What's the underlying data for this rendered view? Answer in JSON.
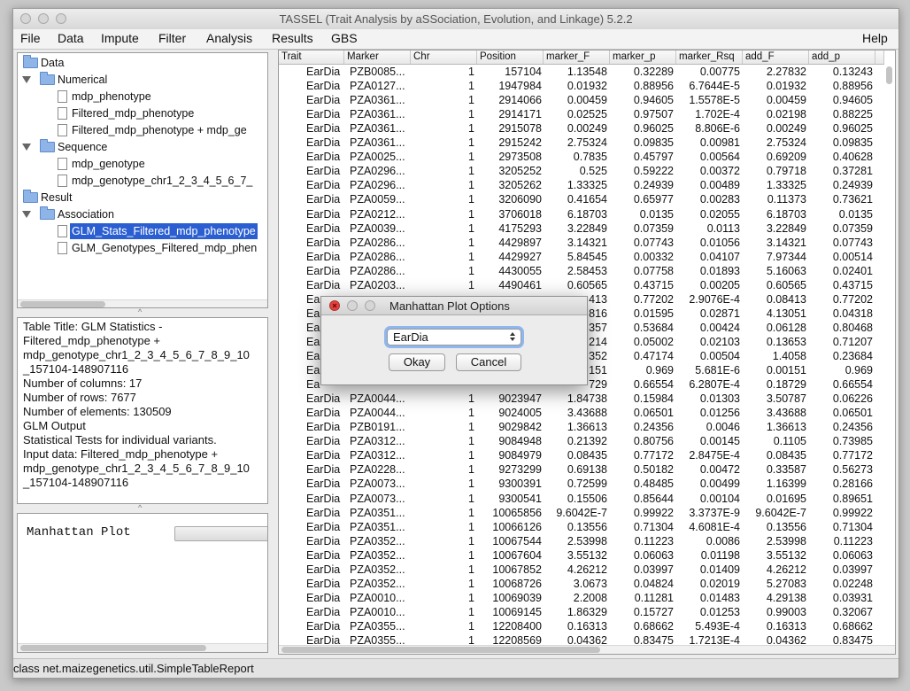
{
  "window": {
    "title": "TASSEL (Trait Analysis by aSSociation, Evolution, and Linkage) 5.2.2"
  },
  "menu": {
    "file": "File",
    "data": "Data",
    "impute": "Impute",
    "filter": "Filter",
    "analysis": "Analysis",
    "results": "Results",
    "gbs": "GBS",
    "help": "Help"
  },
  "tree": {
    "data": "Data",
    "numerical": "Numerical",
    "mdp_phenotype": "mdp_phenotype",
    "filtered_mdp_phenotype": "Filtered_mdp_phenotype",
    "filtered_combo": "Filtered_mdp_phenotype + mdp_ge",
    "sequence": "Sequence",
    "mdp_genotype": "mdp_genotype",
    "mdp_genotype_chr": "mdp_genotype_chr1_2_3_4_5_6_7_",
    "result": "Result",
    "association": "Association",
    "glm_stats": "GLM_Stats_Filtered_mdp_phenotype",
    "glm_genotypes": "GLM_Genotypes_Filtered_mdp_phen"
  },
  "info": {
    "lines": [
      "Table Title: GLM Statistics -",
      "Filtered_mdp_phenotype +",
      "mdp_genotype_chr1_2_3_4_5_6_7_8_9_10",
      "_157104-148907116",
      "Number of columns: 17",
      "Number of rows: 7677",
      "Number of elements: 130509",
      "GLM Output",
      "Statistical Tests for individual variants.",
      "Input data: Filtered_mdp_phenotype +",
      "mdp_genotype_chr1_2_3_4_5_6_7_8_9_10",
      "_157104-148907116"
    ]
  },
  "plot_panel": {
    "title": "Manhattan Plot"
  },
  "table": {
    "headers": [
      "Trait",
      "Marker",
      "Chr",
      "Position",
      "marker_F",
      "marker_p",
      "marker_Rsq",
      "add_F",
      "add_p"
    ],
    "rows": [
      [
        "EarDia",
        "PZB0085...",
        "1",
        "157104",
        "1.13548",
        "0.32289",
        "0.00775",
        "2.27832",
        "0.13243"
      ],
      [
        "EarDia",
        "PZA0127...",
        "1",
        "1947984",
        "0.01932",
        "0.88956",
        "6.7644E-5",
        "0.01932",
        "0.88956"
      ],
      [
        "EarDia",
        "PZA0361...",
        "1",
        "2914066",
        "0.00459",
        "0.94605",
        "1.5578E-5",
        "0.00459",
        "0.94605"
      ],
      [
        "EarDia",
        "PZA0361...",
        "1",
        "2914171",
        "0.02525",
        "0.97507",
        "1.702E-4",
        "0.02198",
        "0.88225"
      ],
      [
        "EarDia",
        "PZA0361...",
        "1",
        "2915078",
        "0.00249",
        "0.96025",
        "8.806E-6",
        "0.00249",
        "0.96025"
      ],
      [
        "EarDia",
        "PZA0361...",
        "1",
        "2915242",
        "2.75324",
        "0.09835",
        "0.00981",
        "2.75324",
        "0.09835"
      ],
      [
        "EarDia",
        "PZA0025...",
        "1",
        "2973508",
        "0.7835",
        "0.45797",
        "0.00564",
        "0.69209",
        "0.40628"
      ],
      [
        "EarDia",
        "PZA0296...",
        "1",
        "3205252",
        "0.525",
        "0.59222",
        "0.00372",
        "0.79718",
        "0.37281"
      ],
      [
        "EarDia",
        "PZA0296...",
        "1",
        "3205262",
        "1.33325",
        "0.24939",
        "0.00489",
        "1.33325",
        "0.24939"
      ],
      [
        "EarDia",
        "PZA0059...",
        "1",
        "3206090",
        "0.41654",
        "0.65977",
        "0.00283",
        "0.11373",
        "0.73621"
      ],
      [
        "EarDia",
        "PZA0212...",
        "1",
        "3706018",
        "6.18703",
        "0.0135",
        "0.02055",
        "6.18703",
        "0.0135"
      ],
      [
        "EarDia",
        "PZA0039...",
        "1",
        "4175293",
        "3.22849",
        "0.07359",
        "0.0113",
        "3.22849",
        "0.07359"
      ],
      [
        "EarDia",
        "PZA0286...",
        "1",
        "4429897",
        "3.14321",
        "0.07743",
        "0.01056",
        "3.14321",
        "0.07743"
      ],
      [
        "EarDia",
        "PZA0286...",
        "1",
        "4429927",
        "5.84545",
        "0.00332",
        "0.04107",
        "7.97344",
        "0.00514"
      ],
      [
        "EarDia",
        "PZA0286...",
        "1",
        "4430055",
        "2.58453",
        "0.07758",
        "0.01893",
        "5.16063",
        "0.02401"
      ],
      [
        "EarDia",
        "PZA0203...",
        "1",
        "4490461",
        "0.60565",
        "0.43715",
        "0.00205",
        "0.60565",
        "0.43715"
      ],
      [
        "Ea",
        "",
        "",
        "",
        "413",
        "0.77202",
        "2.9076E-4",
        "0.08413",
        "0.77202"
      ],
      [
        "Ea",
        "",
        "",
        "",
        "816",
        "0.01595",
        "0.02871",
        "4.13051",
        "0.04318"
      ],
      [
        "Ea",
        "",
        "",
        "",
        "357",
        "0.53684",
        "0.00424",
        "0.06128",
        "0.80468"
      ],
      [
        "Ea",
        "",
        "",
        "",
        "214",
        "0.05002",
        "0.02103",
        "0.13653",
        "0.71207"
      ],
      [
        "Ea",
        "",
        "",
        "",
        "352",
        "0.47174",
        "0.00504",
        "1.4058",
        "0.23684"
      ],
      [
        "Ea",
        "",
        "",
        "",
        "151",
        "0.969",
        "5.681E-6",
        "0.00151",
        "0.969"
      ],
      [
        "Ea",
        "",
        "",
        "",
        "729",
        "0.66554",
        "6.2807E-4",
        "0.18729",
        "0.66554"
      ],
      [
        "EarDia",
        "PZA0044...",
        "1",
        "9023947",
        "1.84738",
        "0.15984",
        "0.01303",
        "3.50787",
        "0.06226"
      ],
      [
        "EarDia",
        "PZA0044...",
        "1",
        "9024005",
        "3.43688",
        "0.06501",
        "0.01256",
        "3.43688",
        "0.06501"
      ],
      [
        "EarDia",
        "PZB0191...",
        "1",
        "9029842",
        "1.36613",
        "0.24356",
        "0.0046",
        "1.36613",
        "0.24356"
      ],
      [
        "EarDia",
        "PZA0312...",
        "1",
        "9084948",
        "0.21392",
        "0.80756",
        "0.00145",
        "0.1105",
        "0.73985"
      ],
      [
        "EarDia",
        "PZA0312...",
        "1",
        "9084979",
        "0.08435",
        "0.77172",
        "2.8475E-4",
        "0.08435",
        "0.77172"
      ],
      [
        "EarDia",
        "PZA0228...",
        "1",
        "9273299",
        "0.69138",
        "0.50182",
        "0.00472",
        "0.33587",
        "0.56273"
      ],
      [
        "EarDia",
        "PZA0073...",
        "1",
        "9300391",
        "0.72599",
        "0.48485",
        "0.00499",
        "1.16399",
        "0.28166"
      ],
      [
        "EarDia",
        "PZA0073...",
        "1",
        "9300541",
        "0.15506",
        "0.85644",
        "0.00104",
        "0.01695",
        "0.89651"
      ],
      [
        "EarDia",
        "PZA0351...",
        "1",
        "10065856",
        "9.6042E-7",
        "0.99922",
        "3.3737E-9",
        "9.6042E-7",
        "0.99922"
      ],
      [
        "EarDia",
        "PZA0351...",
        "1",
        "10066126",
        "0.13556",
        "0.71304",
        "4.6081E-4",
        "0.13556",
        "0.71304"
      ],
      [
        "EarDia",
        "PZA0352...",
        "1",
        "10067544",
        "2.53998",
        "0.11223",
        "0.0086",
        "2.53998",
        "0.11223"
      ],
      [
        "EarDia",
        "PZA0352...",
        "1",
        "10067604",
        "3.55132",
        "0.06063",
        "0.01198",
        "3.55132",
        "0.06063"
      ],
      [
        "EarDia",
        "PZA0352...",
        "1",
        "10067852",
        "4.26212",
        "0.03997",
        "0.01409",
        "4.26212",
        "0.03997"
      ],
      [
        "EarDia",
        "PZA0352...",
        "1",
        "10068726",
        "3.0673",
        "0.04824",
        "0.02019",
        "5.27083",
        "0.02248"
      ],
      [
        "EarDia",
        "PZA0010...",
        "1",
        "10069039",
        "2.2008",
        "0.11281",
        "0.01483",
        "4.29138",
        "0.03931"
      ],
      [
        "EarDia",
        "PZA0010...",
        "1",
        "10069145",
        "1.86329",
        "0.15727",
        "0.01253",
        "0.99003",
        "0.32067"
      ],
      [
        "EarDia",
        "PZA0355...",
        "1",
        "12208400",
        "0.16313",
        "0.68662",
        "5.493E-4",
        "0.16313",
        "0.68662"
      ],
      [
        "EarDia",
        "PZA0355...",
        "1",
        "12208569",
        "0.04362",
        "0.83475",
        "1.7213E-4",
        "0.04362",
        "0.83475"
      ]
    ]
  },
  "dialog": {
    "title": "Manhattan Plot Options",
    "selected_trait": "EarDia",
    "okay_label": "Okay",
    "cancel_label": "Cancel"
  },
  "status": {
    "text": "class net.maizegenetics.util.SimpleTableReport"
  },
  "colors": {
    "selection": "#2b5fd1",
    "folder": "#8fb4e8",
    "focus_ring": "#8fb6ee"
  }
}
